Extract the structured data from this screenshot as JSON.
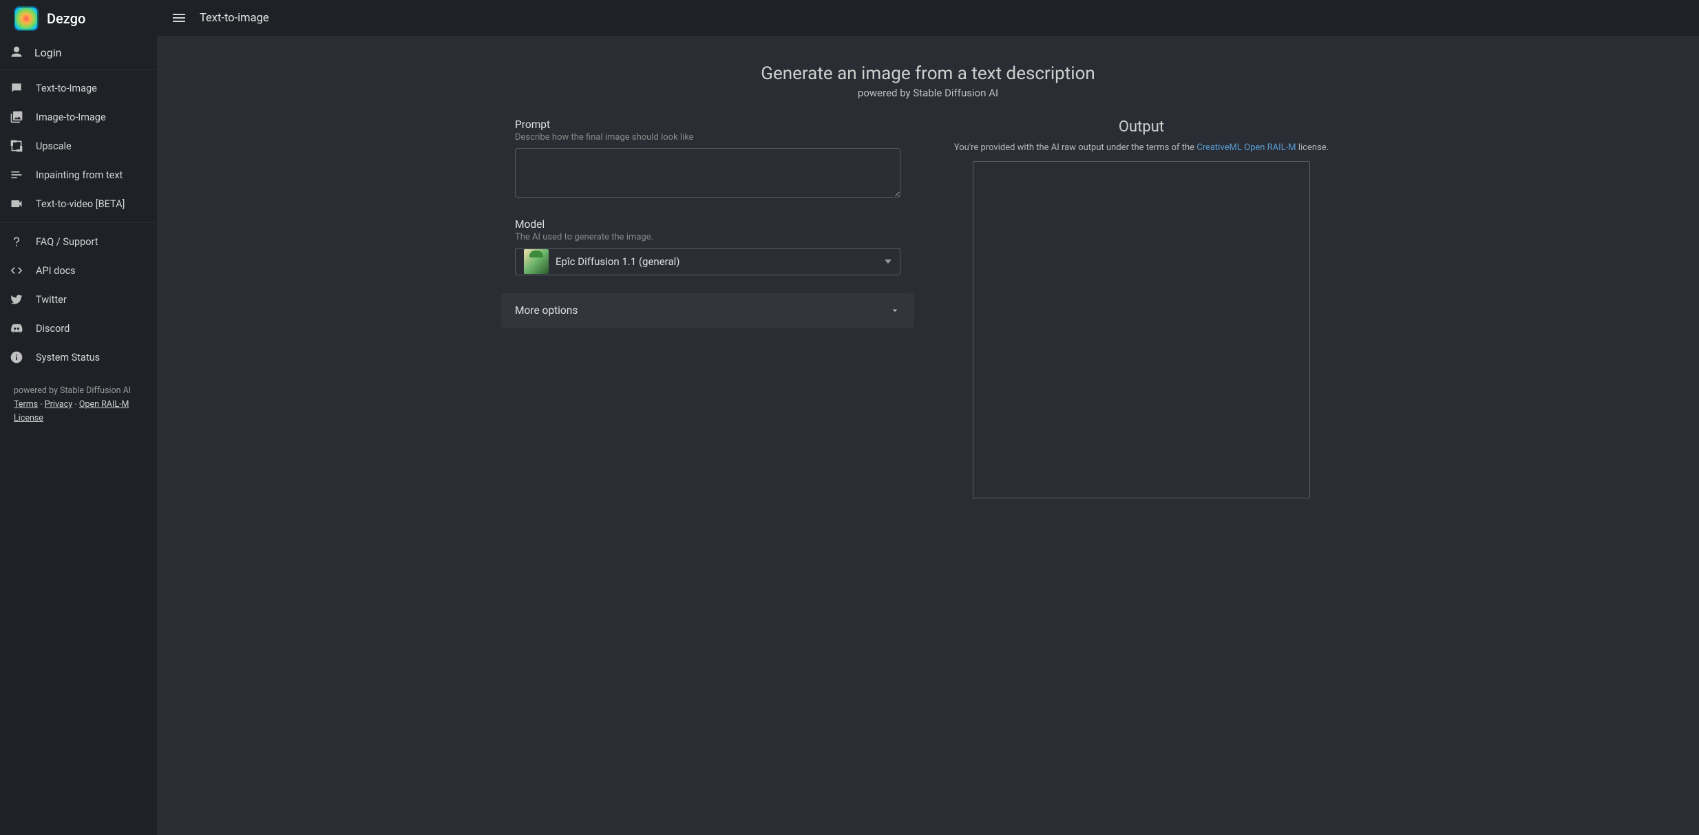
{
  "app_name": "Dezgo",
  "account": {
    "login_label": "Login"
  },
  "nav": {
    "group1": [
      {
        "label": "Text-to-Image"
      },
      {
        "label": "Image-to-Image"
      },
      {
        "label": "Upscale"
      },
      {
        "label": "Inpainting from text"
      },
      {
        "label": "Text-to-video [BETA]"
      }
    ],
    "group2": [
      {
        "label": "FAQ / Support"
      },
      {
        "label": "API docs"
      },
      {
        "label": "Twitter"
      },
      {
        "label": "Discord"
      },
      {
        "label": "System Status"
      }
    ]
  },
  "footer": {
    "powered": "powered by Stable Diffusion AI",
    "terms": "Terms",
    "privacy": "Privacy",
    "license": "Open RAIL-M License",
    "sep": " - "
  },
  "topbar": {
    "title": "Text-to-image"
  },
  "heading": {
    "title": "Generate an image from a text description",
    "subtitle": "powered by Stable Diffusion AI"
  },
  "form": {
    "prompt": {
      "label": "Prompt",
      "desc": "Describe how the final image should look like",
      "value": ""
    },
    "model": {
      "label": "Model",
      "desc": "The AI used to generate the image.",
      "selected": "Epîc Diffusion 1.1 (general)"
    },
    "more_options": "More options"
  },
  "output": {
    "title": "Output",
    "license_prefix": "You're provided with the AI raw output under the terms of the ",
    "license_link": "CreativeML Open RAIL-M",
    "license_suffix": " license."
  }
}
